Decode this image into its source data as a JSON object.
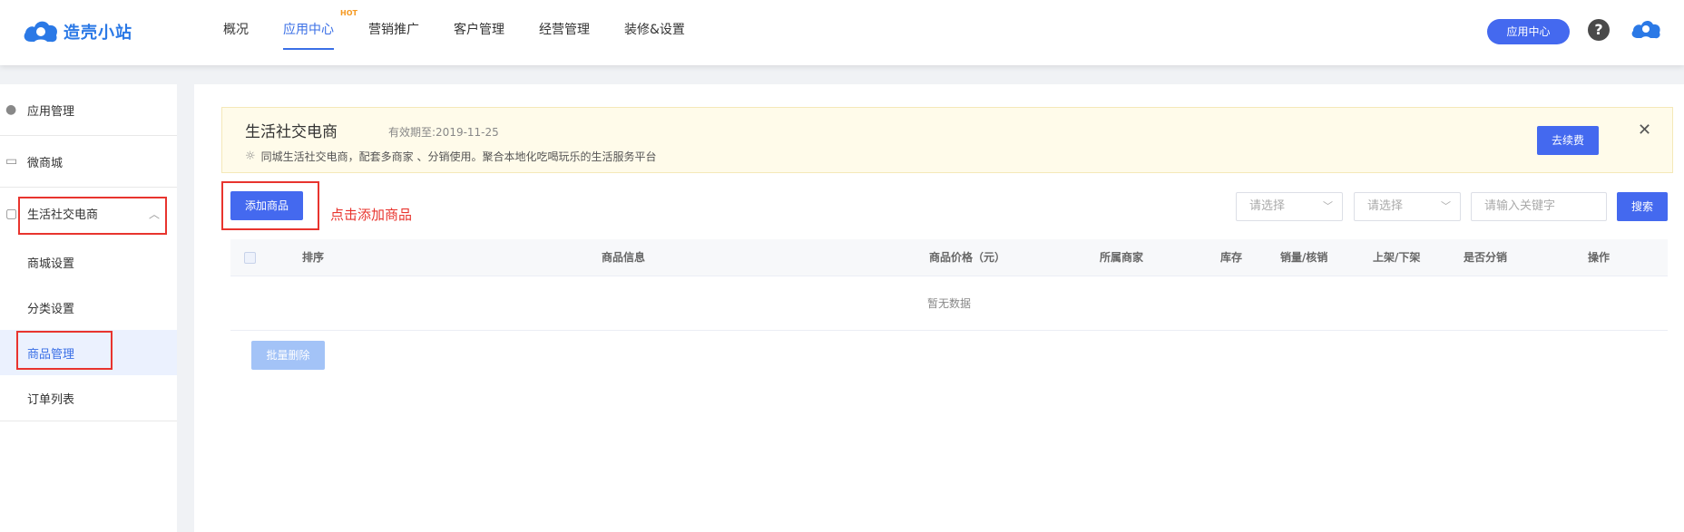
{
  "brand": {
    "name": "造壳小站"
  },
  "nav": {
    "items": [
      {
        "label": "概况"
      },
      {
        "label": "应用中心",
        "badge": "HOT"
      },
      {
        "label": "营销推广"
      },
      {
        "label": "客户管理"
      },
      {
        "label": "经营管理"
      },
      {
        "label": "装修&设置"
      }
    ],
    "active_index": 1
  },
  "header": {
    "app_center_label": "应用中心",
    "help_symbol": "?"
  },
  "sidebar": {
    "items": [
      {
        "label": "应用管理",
        "icon": "drop-icon"
      },
      {
        "label": "微商城",
        "icon": "store-icon"
      },
      {
        "label": "生活社交电商",
        "icon": "bag-icon",
        "expanded": true
      }
    ],
    "sub_items": [
      {
        "label": "商城设置"
      },
      {
        "label": "分类设置"
      },
      {
        "label": "商品管理",
        "active": true
      },
      {
        "label": "订单列表"
      }
    ]
  },
  "notice": {
    "title": "生活社交电商",
    "expire": "有效期至:2019-11-25",
    "desc": "同城生活社交电商，配套多商家 、分销使用。聚合本地化吃喝玩乐的生活服务平台",
    "renew_label": "去续费",
    "close_symbol": "✕"
  },
  "toolbar": {
    "add_label": "添加商品",
    "hint": "点击添加商品",
    "select1_placeholder": "请选择",
    "select2_placeholder": "请选择",
    "keyword_placeholder": "请输入关键字",
    "search_label": "搜索"
  },
  "table": {
    "columns": [
      "排序",
      "商品信息",
      "商品价格（元）",
      "所属商家",
      "库存",
      "销量/核销",
      "上架/下架",
      "是否分销",
      "操作"
    ],
    "empty_text": "暂无数据",
    "batch_delete_label": "批量删除"
  },
  "colors": {
    "accent": "#4469ef",
    "annotation": "#e8342e",
    "notice_bg": "#fffbea"
  }
}
